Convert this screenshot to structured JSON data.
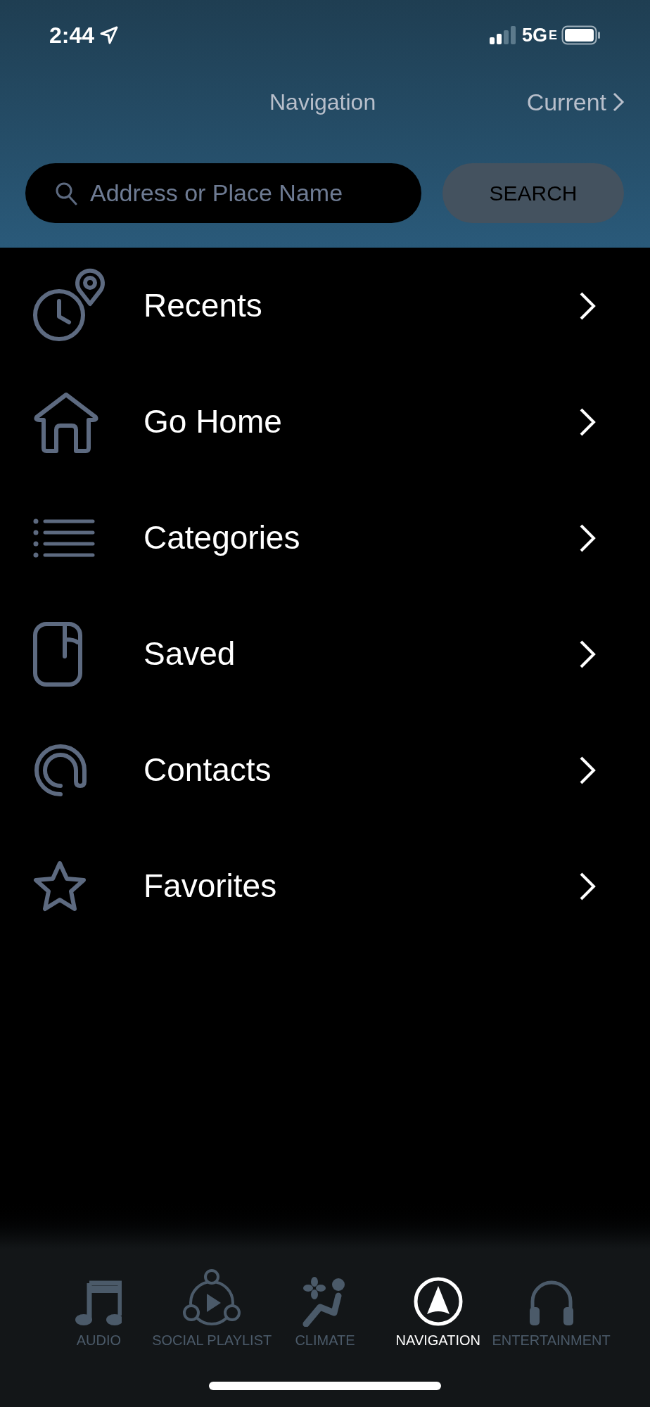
{
  "status_bar": {
    "time": "2:44",
    "network": "5G",
    "network_suffix": "E"
  },
  "header": {
    "title": "Navigation",
    "current_link": "Current"
  },
  "search": {
    "placeholder": "Address or Place Name",
    "button": "SEARCH"
  },
  "menu": [
    {
      "kind": "recents",
      "label": "Recents"
    },
    {
      "kind": "home",
      "label": "Go Home"
    },
    {
      "kind": "categories",
      "label": "Categories"
    },
    {
      "kind": "saved",
      "label": "Saved"
    },
    {
      "kind": "contacts",
      "label": "Contacts"
    },
    {
      "kind": "favorites",
      "label": "Favorites"
    }
  ],
  "tab_bar": [
    {
      "kind": "audio",
      "label": "AUDIO",
      "selected": false
    },
    {
      "kind": "social",
      "label": "SOCIAL PLAYLIST",
      "selected": false
    },
    {
      "kind": "climate",
      "label": "CLIMATE",
      "selected": false
    },
    {
      "kind": "navigation",
      "label": "NAVIGATION",
      "selected": true
    },
    {
      "kind": "entertainment",
      "label": "ENTERTAINMENT",
      "selected": false
    }
  ]
}
